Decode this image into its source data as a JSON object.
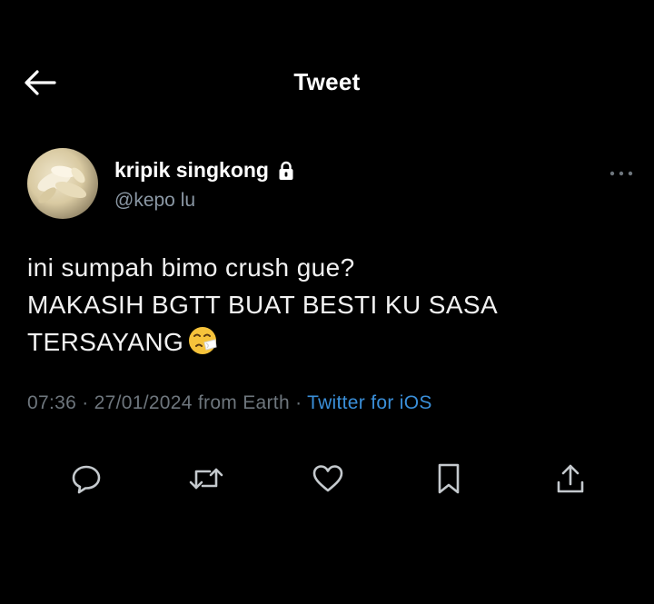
{
  "header": {
    "title": "Tweet",
    "back_icon": "arrow-left-icon"
  },
  "author": {
    "display_name": "kripik singkong",
    "handle": "@kepo lu",
    "lock_icon": "lock-icon",
    "avatar_icon": "avatar"
  },
  "tweet": {
    "lines": [
      "ini sumpah bimo crush gue?",
      "MAKASIH BGTT BUAT BESTI KU SASA",
      "TERSAYANG"
    ],
    "emoji_icon": "sneezing-face-emoji-icon"
  },
  "meta": {
    "time": "07:36",
    "separator": "·",
    "date": "27/01/2024",
    "location": "from Earth",
    "source": "Twitter for iOS"
  },
  "actions": [
    {
      "name": "reply",
      "icon": "reply-icon"
    },
    {
      "name": "retweet",
      "icon": "retweet-icon"
    },
    {
      "name": "like",
      "icon": "heart-icon"
    },
    {
      "name": "bookmark",
      "icon": "bookmark-icon"
    },
    {
      "name": "share",
      "icon": "share-icon"
    }
  ],
  "colors": {
    "background": "#000000",
    "text": "#ffffff",
    "secondary": "#8b98a5",
    "link": "#3a8fd9",
    "icon": "#c4c9cd"
  }
}
